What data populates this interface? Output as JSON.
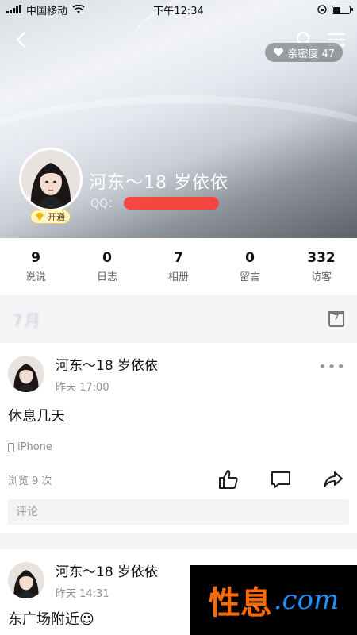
{
  "status_bar": {
    "carrier": "中国移动",
    "time": "下午12:34"
  },
  "header": {
    "intimacy_label": "亲密度 47",
    "profile_name": "河东～18 岁依依",
    "qq_label": "QQ：",
    "vip_label": "开通"
  },
  "stats": [
    {
      "value": "9",
      "label": "说说"
    },
    {
      "value": "0",
      "label": "日志"
    },
    {
      "value": "7",
      "label": "相册"
    },
    {
      "value": "0",
      "label": "留言"
    },
    {
      "value": "332",
      "label": "访客"
    }
  ],
  "month_bar": {
    "label": "7月",
    "calendar_day": "7"
  },
  "posts": [
    {
      "author": "河东～18 岁依依",
      "time": "昨天 17:00",
      "text": "休息几天",
      "device": "iPhone",
      "views": "浏览 9 次",
      "comment_placeholder": "评论"
    },
    {
      "author": "河东～18 岁依依",
      "time": "昨天 14:31",
      "text": "东广场附近☺"
    }
  ],
  "watermark": {
    "cn": "性息",
    "en": ".com"
  }
}
